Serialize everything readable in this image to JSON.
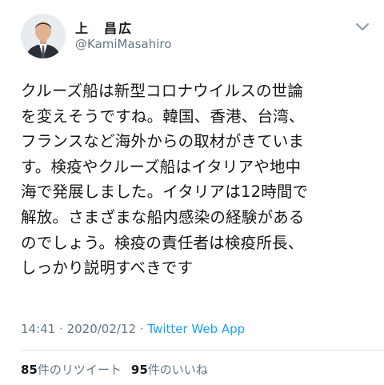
{
  "tweet": {
    "author": {
      "name": "上　昌広",
      "handle": "@KamiMasahiro"
    },
    "text_lines": [
      "クルーズ船は新型コロナウイルスの世論",
      "を変えそうですね。韓国、香港、台湾、",
      "フランスなど海外からの取材がきていま",
      "す。検疫やクルーズ船はイタリアや地中",
      "海で発展しました。イタリアは12時間で",
      "解放。さまざまな船内感染の経験がある",
      "のでしょう。検疫の責任者は検疫所長、",
      "しっかり説明すべきです"
    ],
    "time": "14:41",
    "separator": "·",
    "date": "2020/02/12",
    "source_app": "Twitter Web App",
    "retweets": {
      "count": "85",
      "label": "件のリツイート"
    },
    "likes": {
      "count": "95",
      "label": "件のいいね"
    }
  },
  "colors": {
    "link": "#1da1f2",
    "secondary": "#657786",
    "divider": "#e1e8ed"
  },
  "icons": {
    "menu": "chevron-down-icon"
  }
}
